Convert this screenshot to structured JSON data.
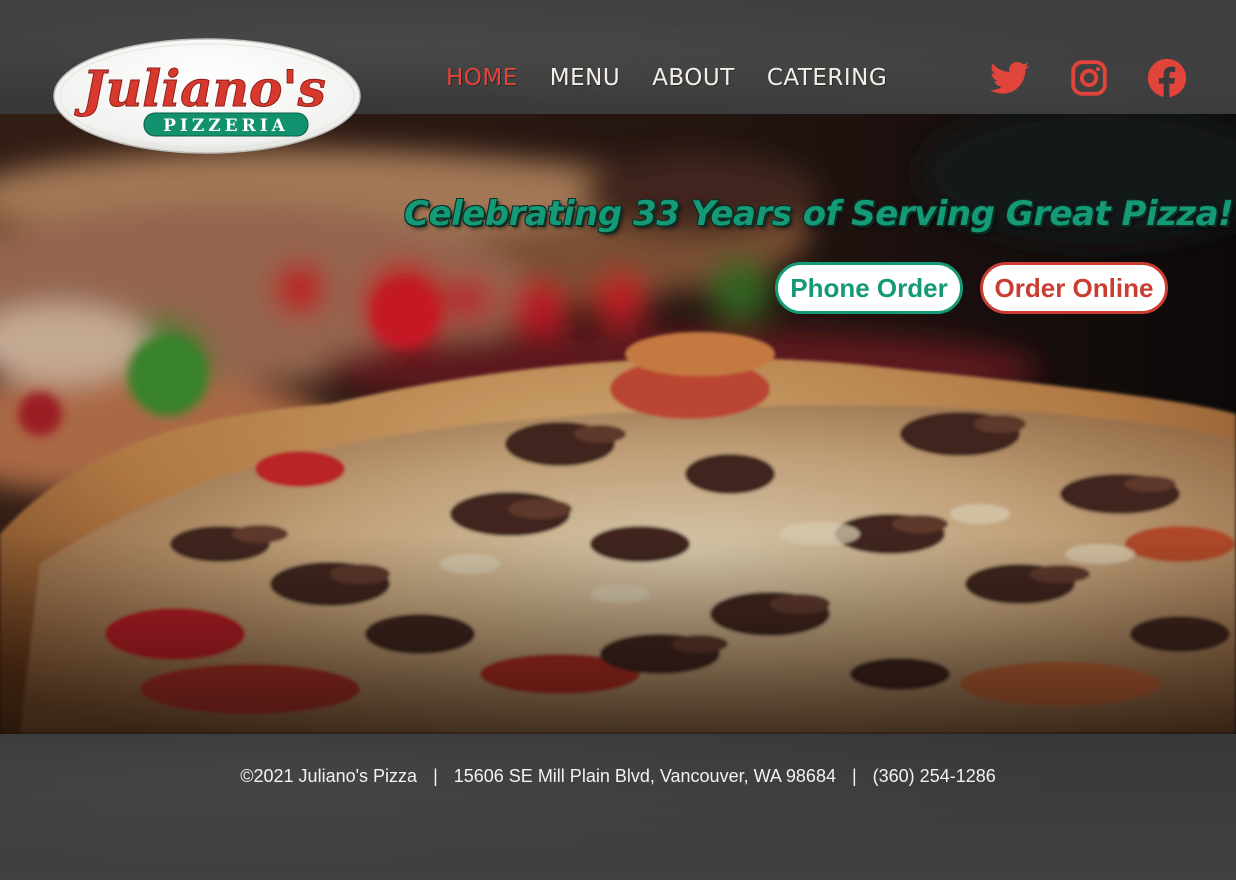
{
  "brand": {
    "logo_script": "Juliano's",
    "logo_banner": "PIZZERIA"
  },
  "nav": {
    "items": [
      {
        "label": "HOME",
        "active": true
      },
      {
        "label": "MENU",
        "active": false
      },
      {
        "label": "ABOUT",
        "active": false
      },
      {
        "label": "CATERING",
        "active": false
      }
    ]
  },
  "social": {
    "icons": [
      "twitter-icon",
      "instagram-icon",
      "facebook-icon"
    ],
    "color": "#e0443a"
  },
  "hero": {
    "tagline": "Celebrating 33 Years of Serving Great Pizza!",
    "phone_order_label": "Phone Order",
    "order_online_label": "Order Online"
  },
  "footer": {
    "copyright": "©2021 Juliano's Pizza",
    "separator": "|",
    "address": "15606 SE Mill Plain Blvd, Vancouver, WA 98684",
    "phone": "(360) 254-1286"
  },
  "colors": {
    "accent_red": "#e0443a",
    "accent_green": "#159a78",
    "background_dark": "#3a3a3a"
  }
}
